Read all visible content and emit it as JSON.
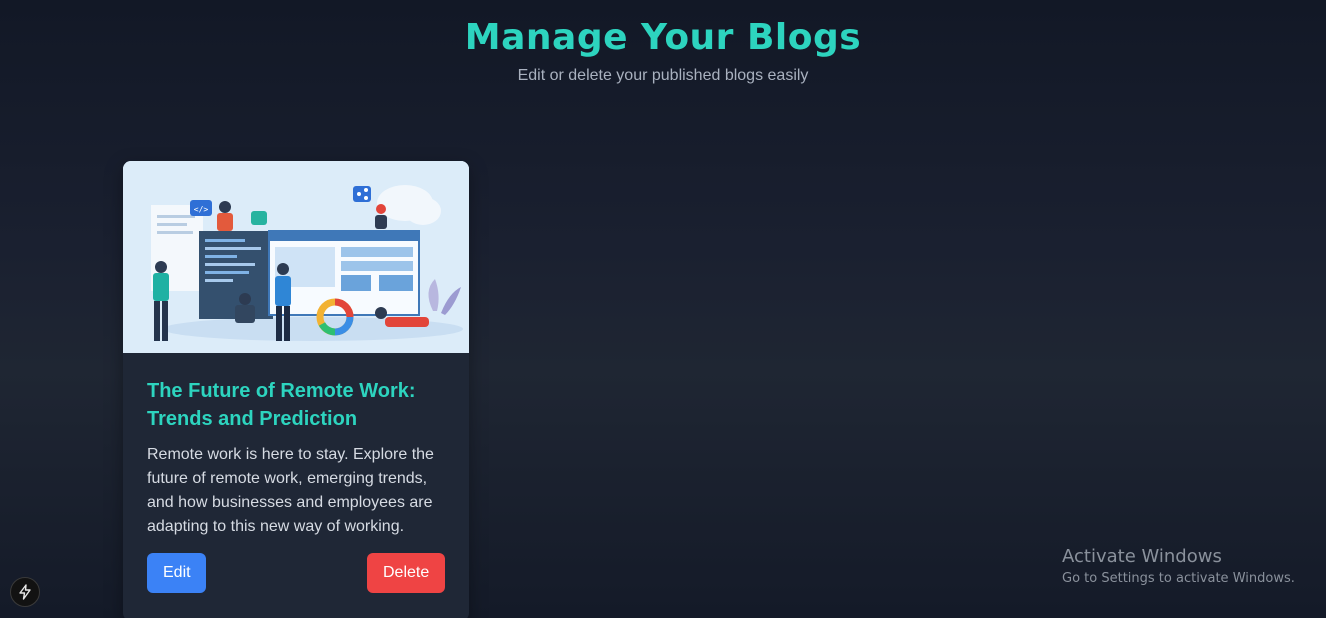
{
  "header": {
    "title": "Manage Your Blogs",
    "subtitle": "Edit or delete your published blogs easily"
  },
  "blogs": [
    {
      "image_icon": "remote-work-illustration-image",
      "title": "The Future of Remote Work: Trends and Prediction",
      "description": "Remote work is here to stay. Explore the future of remote work, emerging trends, and how businesses and employees are adapting to this new way of working.",
      "edit_label": "Edit",
      "delete_label": "Delete"
    }
  ],
  "windows_watermark": {
    "title": "Activate Windows",
    "subtitle": "Go to Settings to activate Windows."
  },
  "dev_indicator": {
    "icon": "lightning-bolt-icon"
  },
  "colors": {
    "accent": "#2dd4bf",
    "edit_button": "#3b82f6",
    "delete_button": "#ef4444",
    "card_background": "#1f2736"
  }
}
